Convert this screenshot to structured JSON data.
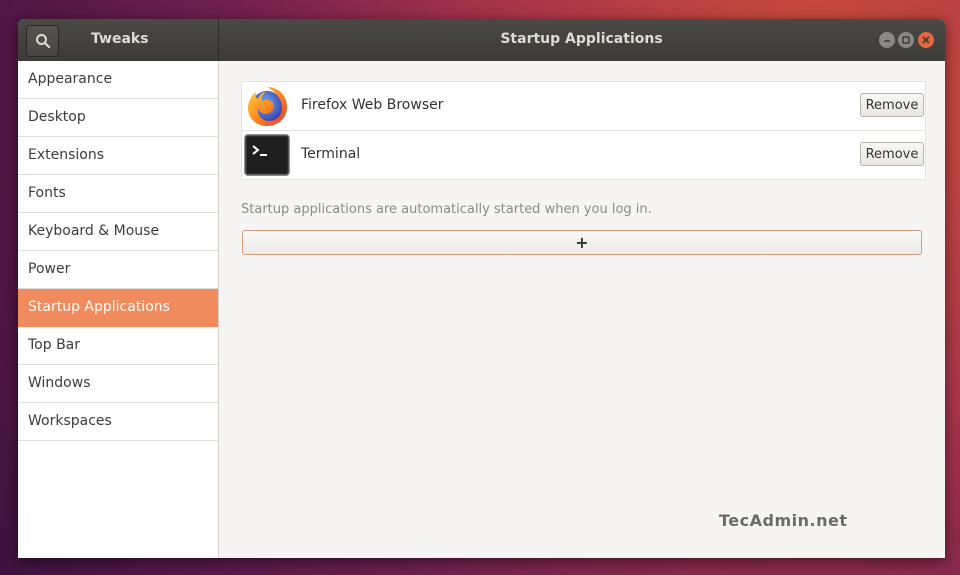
{
  "header": {
    "sidebar_title": "Tweaks",
    "title": "Startup Applications"
  },
  "sidebar": {
    "items": [
      {
        "label": "Appearance"
      },
      {
        "label": "Desktop"
      },
      {
        "label": "Extensions"
      },
      {
        "label": "Fonts"
      },
      {
        "label": "Keyboard & Mouse"
      },
      {
        "label": "Power"
      },
      {
        "label": "Startup Applications",
        "selected": true
      },
      {
        "label": "Top Bar"
      },
      {
        "label": "Windows"
      },
      {
        "label": "Workspaces"
      }
    ]
  },
  "startup": {
    "apps": [
      {
        "name": "Firefox Web Browser",
        "icon": "firefox-icon",
        "remove_label": "Remove"
      },
      {
        "name": "Terminal",
        "icon": "terminal-icon",
        "remove_label": "Remove"
      }
    ],
    "hint": "Startup applications are automatically started when you log in.",
    "add_label": "+"
  },
  "watermark": "TecAdmin.net",
  "colors": {
    "accent": "#f08b5d",
    "titlebar": "#3c3b37",
    "close_button": "#e9653c"
  }
}
